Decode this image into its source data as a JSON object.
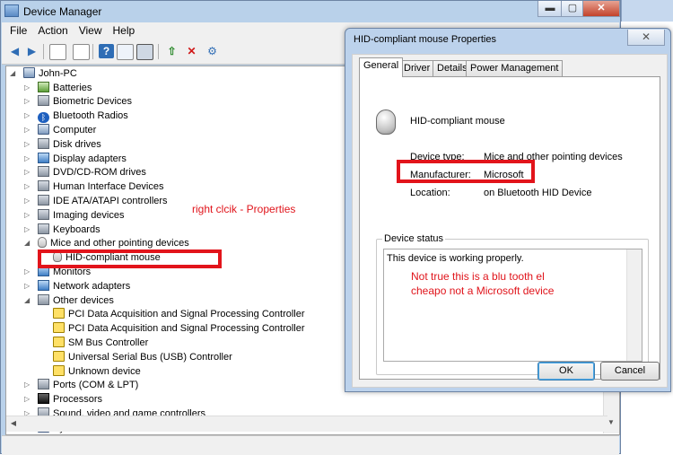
{
  "colors": {
    "annotation_red": "#e2141b",
    "titlebar": "#b9d1ea",
    "selection_box": "#e2141b"
  },
  "device_manager": {
    "title": "Device Manager",
    "window_buttons": {
      "minimize": "▬",
      "maximize": "▢",
      "close": "✕"
    },
    "menu": [
      "File",
      "Action",
      "View",
      "Help"
    ],
    "toolbar_icons": [
      "back-arrow-icon",
      "forward-arrow-icon",
      "show-hide-tree-icon",
      "properties-icon",
      "help-icon",
      "show-hidden-icon",
      "update-driver-icon",
      "uninstall-icon",
      "scan-hardware-icon"
    ],
    "tree": {
      "root": "John-PC",
      "items": [
        {
          "label": "Batteries",
          "icon": "battery-icon"
        },
        {
          "label": "Biometric Devices",
          "icon": "biometric-icon"
        },
        {
          "label": "Bluetooth Radios",
          "icon": "bluetooth-icon"
        },
        {
          "label": "Computer",
          "icon": "computer-icon"
        },
        {
          "label": "Disk drives",
          "icon": "disk-drive-icon"
        },
        {
          "label": "Display adapters",
          "icon": "display-adapter-icon"
        },
        {
          "label": "DVD/CD-ROM drives",
          "icon": "dvd-drive-icon"
        },
        {
          "label": "Human Interface Devices",
          "icon": "hid-icon"
        },
        {
          "label": "IDE ATA/ATAPI controllers",
          "icon": "ide-controller-icon"
        },
        {
          "label": "Imaging devices",
          "icon": "camera-icon"
        },
        {
          "label": "Keyboards",
          "icon": "keyboard-icon"
        },
        {
          "label": "Mice and other pointing devices",
          "icon": "mouse-icon"
        },
        {
          "label": "HID-compliant mouse",
          "icon": "mouse-icon"
        },
        {
          "label": "Monitors",
          "icon": "monitor-icon"
        },
        {
          "label": "Network adapters",
          "icon": "network-adapter-icon"
        },
        {
          "label": "Other devices",
          "icon": "unknown-device-icon"
        },
        {
          "label": "PCI Data Acquisition and Signal Processing Controller",
          "icon": "warning-device-icon"
        },
        {
          "label": "PCI Data Acquisition and Signal Processing Controller",
          "icon": "warning-device-icon"
        },
        {
          "label": "SM Bus Controller",
          "icon": "warning-device-icon"
        },
        {
          "label": "Universal Serial Bus (USB) Controller",
          "icon": "warning-device-icon"
        },
        {
          "label": "Unknown device",
          "icon": "warning-device-icon"
        },
        {
          "label": "Ports (COM & LPT)",
          "icon": "port-icon"
        },
        {
          "label": "Processors",
          "icon": "processor-icon"
        },
        {
          "label": "Sound, video and game controllers",
          "icon": "sound-icon"
        },
        {
          "label": "System devices",
          "icon": "system-device-icon"
        }
      ]
    },
    "annotation": "right clcik - Properties"
  },
  "properties_dialog": {
    "title": "HID-compliant mouse Properties",
    "close": "✕",
    "tabs": [
      "General",
      "Driver",
      "Details",
      "Power Management"
    ],
    "device_name": "HID-compliant mouse",
    "fields": {
      "device_type_label": "Device type:",
      "device_type_value": "Mice and other pointing devices",
      "manufacturer_label": "Manufacturer:",
      "manufacturer_value": "Microsoft",
      "location_label": "Location:",
      "location_value": "on Bluetooth HID Device"
    },
    "status_legend": "Device status",
    "status_text": "This device is working properly.",
    "annotation": "Not true this is a blu tooth el cheapo not a Microsoft device",
    "ok": "OK",
    "cancel": "Cancel"
  }
}
